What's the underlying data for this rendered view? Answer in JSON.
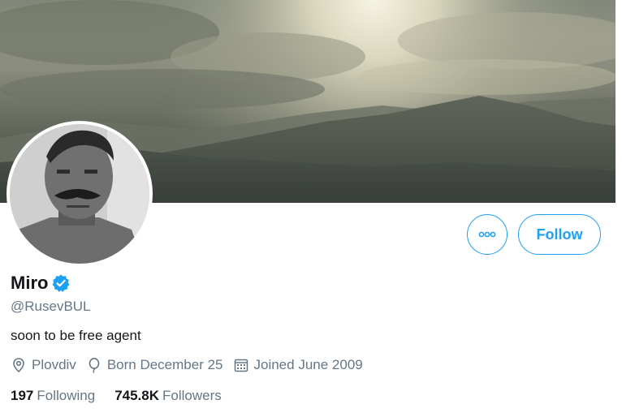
{
  "profile": {
    "name": "Miro",
    "handle": "@RusevBUL",
    "bio": "soon to be free agent",
    "location": "Plovdiv",
    "birthday": "Born December 25",
    "joined": "Joined June 2009"
  },
  "stats": {
    "following_count": "197",
    "following_label": "Following",
    "followers_count": "745.8K",
    "followers_label": "Followers"
  },
  "actions": {
    "follow_label": "Follow",
    "more_icon": "more-dots-icon"
  },
  "colors": {
    "accent": "#1da1f2",
    "text": "#14171a",
    "muted": "#657786"
  }
}
